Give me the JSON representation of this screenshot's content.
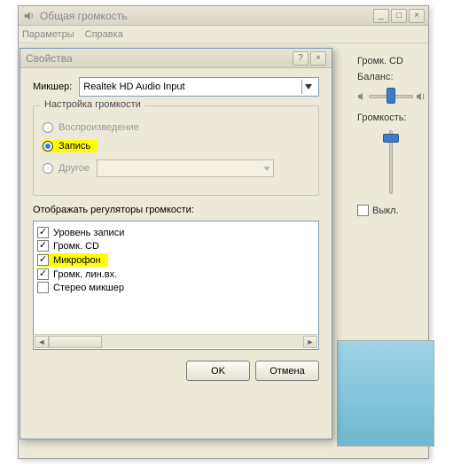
{
  "window": {
    "title": "Общая громкость",
    "menu": {
      "params": "Параметры",
      "help": "Справка"
    }
  },
  "panel": {
    "title": "Громк. CD",
    "balance_label": "Баланс:",
    "volume_label": "Громкость:",
    "mute_label": "Выкл."
  },
  "dialog": {
    "title": "Свойства",
    "mixer_label": "Микшер:",
    "mixer_value": "Realtek HD Audio Input",
    "group_legend": "Настройка громкости",
    "radio": {
      "playback": "Воспроизведение",
      "record": "Запись",
      "other": "Другое"
    },
    "list_label": "Отображать регуляторы громкости:",
    "items": [
      {
        "label": "Уровень записи",
        "checked": true
      },
      {
        "label": "Громк. CD",
        "checked": true
      },
      {
        "label": "Микрофон",
        "checked": true,
        "highlight": true
      },
      {
        "label": "Громк. лин.вх.",
        "checked": true
      },
      {
        "label": "Стерео микшер",
        "checked": false
      }
    ],
    "buttons": {
      "ok": "OK",
      "cancel": "Отмена"
    }
  }
}
